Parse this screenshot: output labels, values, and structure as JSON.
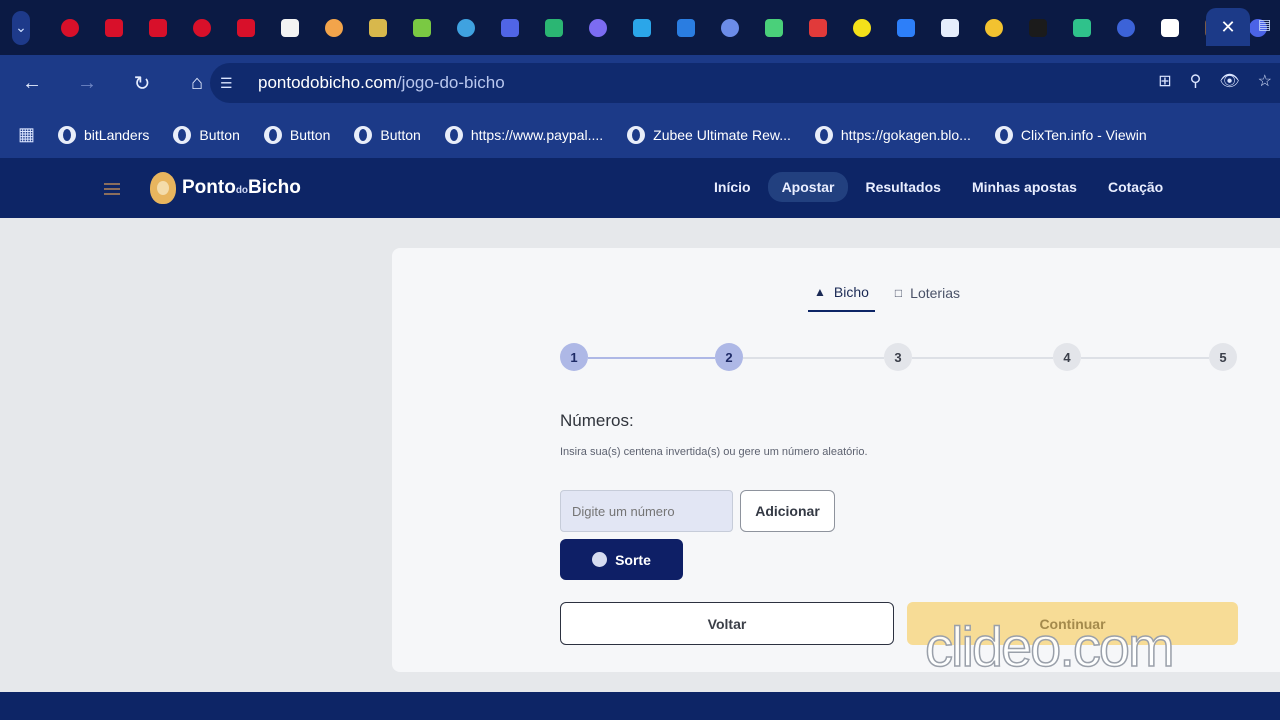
{
  "browser": {
    "tab_icon_colors": [
      "#d8102a",
      "#d8102a",
      "#d8102a",
      "#d8102a",
      "#d8102a",
      "#f3f3f3",
      "#f2a44b",
      "#d8b84c",
      "#7ac943",
      "#3fa2e0",
      "#5065e6",
      "#2bb673",
      "#7c6cf2",
      "#2ba6e9",
      "#2a7de1",
      "#6c8ce8",
      "#4ad07a",
      "#e13a3a",
      "#f4e11a",
      "#2d7ff9",
      "#e6eefc",
      "#f2c230",
      "#1b1b1b",
      "#2fc28b",
      "#3c63d8",
      "#ffffff",
      "#7a5a46",
      "#4b63e6"
    ],
    "url_host": "pontodobicho.com",
    "url_path": "/jogo-do-bicho",
    "bookmarks": [
      "bitLanders",
      "Button",
      "Button",
      "Button",
      "https://www.paypal....",
      "Zubee Ultimate Rew...",
      "https://gokagen.blo...",
      "ClixTen.info - Viewin"
    ]
  },
  "site": {
    "logo_main": "Ponto",
    "logo_small": "do",
    "logo_tail": "Bicho",
    "nav": [
      "Início",
      "Apostar",
      "Resultados",
      "Minhas apostas",
      "Cotação"
    ],
    "active_nav": "Apostar"
  },
  "tabs": {
    "bicho": "Bicho",
    "loterias": "Loterias"
  },
  "stepper": {
    "steps": [
      "1",
      "2",
      "3",
      "4",
      "5"
    ],
    "completed": 2
  },
  "form": {
    "title": "Números:",
    "description": "Insira sua(s) centena invertida(s) ou gere um número aleatório.",
    "input_placeholder": "Digite um número",
    "add_label": "Adicionar",
    "sorte_label": "Sorte",
    "voltar_label": "Voltar",
    "continuar_label": "Continuar"
  },
  "watermark": "clideo.com",
  "colors": {
    "navy": "#0d2566",
    "accent_yellow": "#f7dc96",
    "step_done": "#aeb8e6"
  }
}
